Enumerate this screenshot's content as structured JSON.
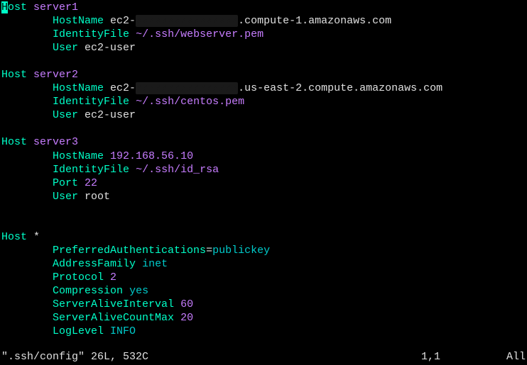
{
  "hosts": [
    {
      "keyword": "Host",
      "alias": "server1",
      "first_char": "H",
      "rest": "ost ",
      "directives": [
        {
          "name": "HostName",
          "value_pre": "ec2-",
          "redacted": "xxxxxxxxxxxxxxxx",
          "value_post": ".compute-1.amazonaws.com"
        },
        {
          "name": "IdentityFile",
          "value": "~/.ssh/webserver.pem"
        },
        {
          "name": "User",
          "value": "ec2-user"
        }
      ]
    },
    {
      "keyword": "Host",
      "alias": "server2",
      "directives": [
        {
          "name": "HostName",
          "value_pre": "ec2-",
          "redacted": "xxxxxxxxxxxxxxxx",
          "value_post": ".us-east-2.compute.amazonaws.com"
        },
        {
          "name": "IdentityFile",
          "value": "~/.ssh/centos.pem"
        },
        {
          "name": "User",
          "value": "ec2-user"
        }
      ]
    },
    {
      "keyword": "Host",
      "alias": "server3",
      "directives": [
        {
          "name": "HostName",
          "value": "192.168.56.10"
        },
        {
          "name": "IdentityFile",
          "value": "~/.ssh/id_rsa"
        },
        {
          "name": "Port",
          "value": "22"
        },
        {
          "name": "User",
          "value": "root"
        }
      ]
    },
    {
      "keyword": "Host",
      "alias": "*",
      "directives": [
        {
          "name": "PreferredAuthentications",
          "sep": "=",
          "value": "publickey",
          "value_class": "ident"
        },
        {
          "name": "AddressFamily",
          "value": "inet",
          "value_class": "ident"
        },
        {
          "name": "Protocol",
          "value": "2",
          "value_class": "number"
        },
        {
          "name": "Compression",
          "value": "yes",
          "value_class": "ident"
        },
        {
          "name": "ServerAliveInterval",
          "value": "60",
          "value_class": "number"
        },
        {
          "name": "ServerAliveCountMax",
          "value": "20",
          "value_class": "number"
        },
        {
          "name": "LogLevel",
          "value": "INFO",
          "value_class": "ident"
        }
      ]
    }
  ],
  "status": {
    "filename": "\".ssh/config\"",
    "info": "26L, 532C",
    "position": "1,1",
    "scroll": "All"
  }
}
